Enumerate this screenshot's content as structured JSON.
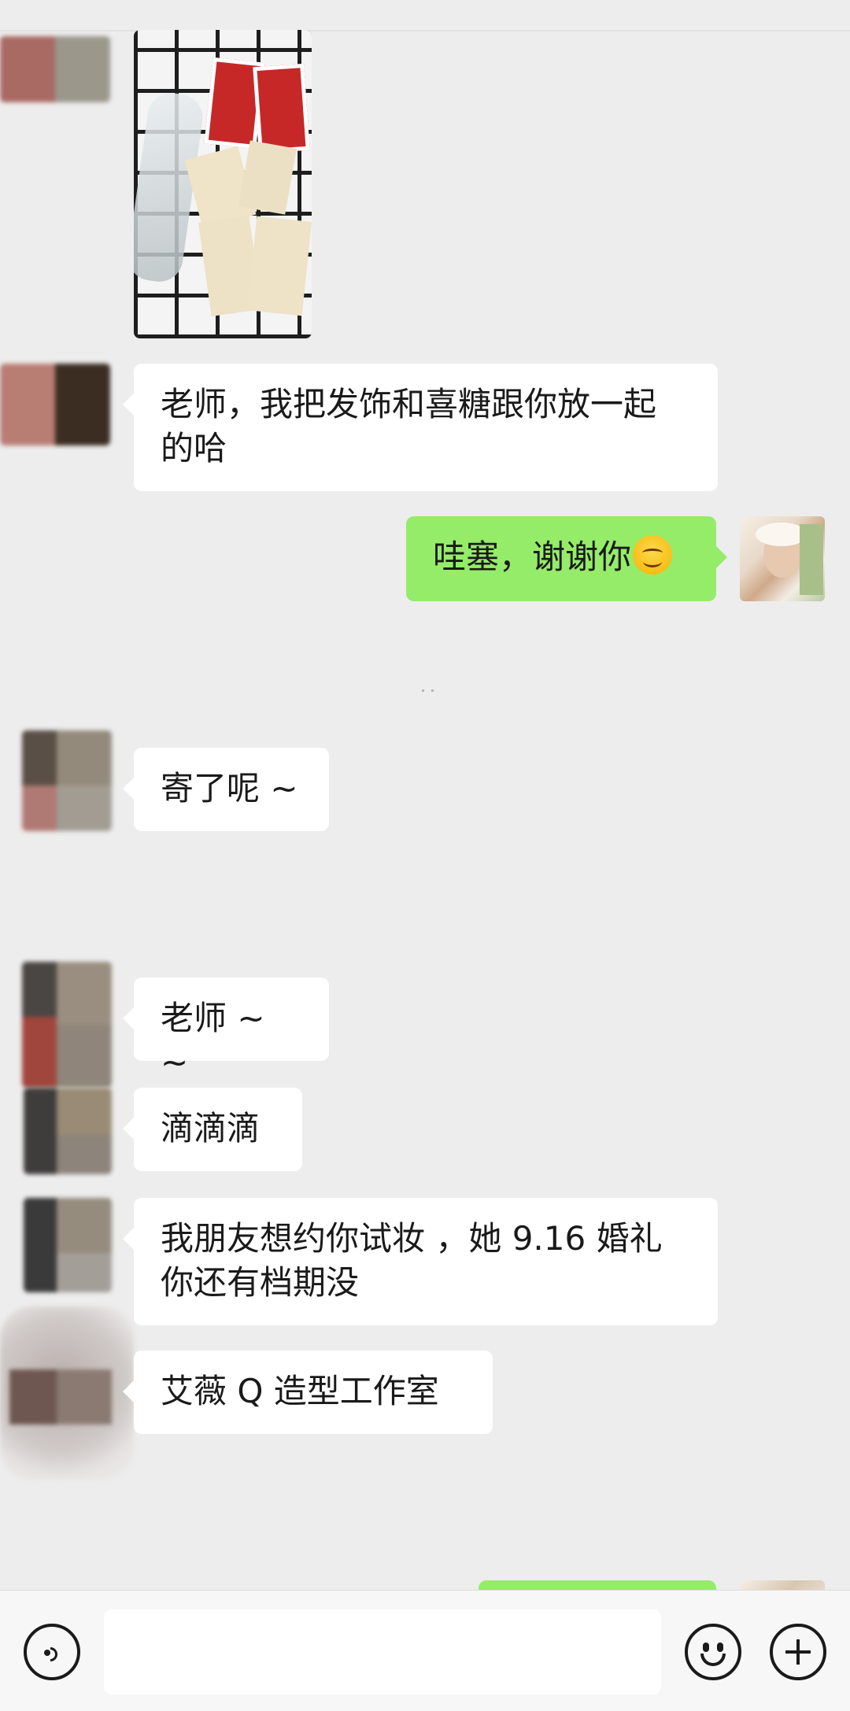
{
  "messages": [
    {
      "side": "left",
      "type": "image",
      "description_name": "snacks-photo"
    },
    {
      "side": "left",
      "type": "text",
      "text": "老师，我把发饰和喜糖跟你放一起的哈"
    },
    {
      "side": "right",
      "type": "text",
      "text": "哇塞，谢谢你",
      "emoji": "smiling-face-emoji"
    },
    {
      "side": "left",
      "type": "text",
      "text": "寄了呢 ~"
    },
    {
      "side": "left",
      "type": "text",
      "text": "老师 ~ ~"
    },
    {
      "side": "left",
      "type": "text",
      "text": "滴滴滴"
    },
    {
      "side": "left",
      "type": "text",
      "text": "我朋友想约你试妆 ，她 9.16 婚礼你还有档期没"
    },
    {
      "side": "left",
      "type": "text",
      "text": "艾薇 Q 造型工作室"
    }
  ],
  "msg1": {
    "line1": "老师，我把发饰和喜糖跟你放一起",
    "line2": "的哈"
  },
  "msg2": {
    "text": "哇塞，谢谢你"
  },
  "msg3": {
    "text": "寄了呢 ~"
  },
  "msg4": {
    "text": "老师 ~ ~"
  },
  "msg5": {
    "text": "滴滴滴"
  },
  "msg6": {
    "line1": "我朋友想约你试妆 ，她 9.16 婚礼",
    "line2": "你还有档期没"
  },
  "msg7": {
    "text": "艾薇 Q 造型工作室"
  },
  "icons": {
    "voice": "voice-input-icon",
    "emoji": "emoji-icon",
    "more": "plus-icon"
  },
  "colors": {
    "background": "#ededed",
    "bubble_in": "#ffffff",
    "bubble_out": "#95ec69",
    "input_bar": "#f7f7f7"
  }
}
